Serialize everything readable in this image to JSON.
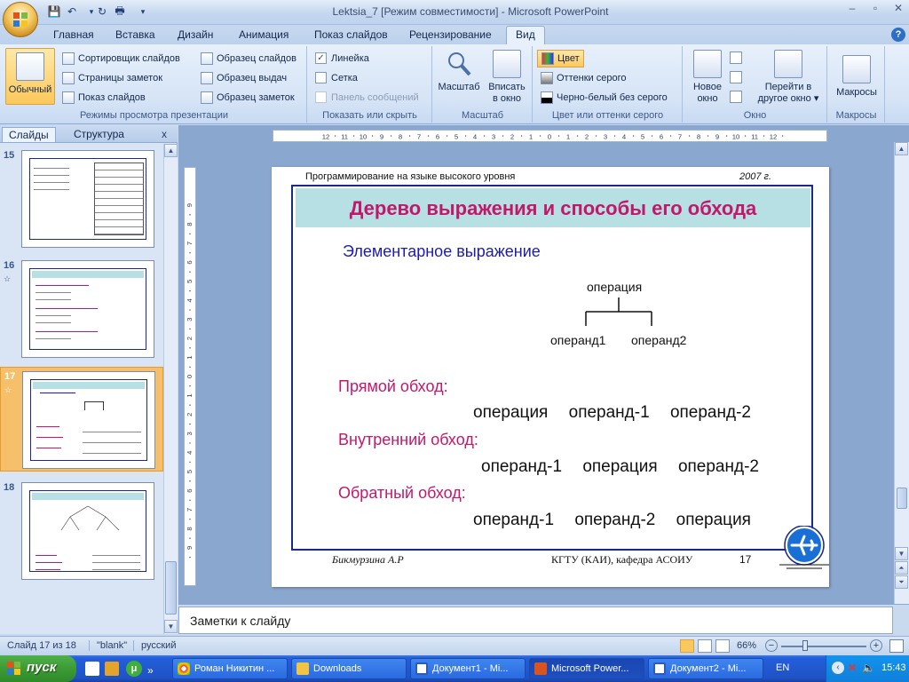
{
  "window": {
    "title": "Lektsia_7 [Режим совместимости] - Microsoft PowerPoint",
    "controls": [
      "–",
      "▫",
      "✕"
    ]
  },
  "qat": [
    "save",
    "undo",
    "redo",
    "print"
  ],
  "tabs": [
    "Главная",
    "Вставка",
    "Дизайн",
    "Анимация",
    "Показ слайдов",
    "Рецензирование",
    "Вид"
  ],
  "ribbon": {
    "views": {
      "normal": "Обычный",
      "sorter": "Сортировщик слайдов",
      "notes_pages": "Страницы заметок",
      "slideshow": "Показ слайдов",
      "label": "Режимы просмотра презентации"
    },
    "masters": {
      "slide_master": "Образец слайдов",
      "handout_master": "Образец выдач",
      "notes_master": "Образец заметок"
    },
    "showhide": {
      "ruler": "Линейка",
      "grid": "Сетка",
      "message_bar": "Панель сообщений",
      "label": "Показать или скрыть"
    },
    "zoom": {
      "zoom": "Масштаб",
      "fit_line1": "Вписать",
      "fit_line2": "в окно",
      "label": "Масштаб"
    },
    "color": {
      "color": "Цвет",
      "grayscale": "Оттенки серого",
      "bw": "Черно-белый без серого",
      "label": "Цвет или оттенки серого"
    },
    "window": {
      "new_line1": "Новое",
      "new_line2": "окно",
      "switch_line1": "Перейти в",
      "switch_line2": "другое окно",
      "label": "Окно"
    },
    "macros": {
      "macros": "Макросы",
      "label": "Макросы"
    }
  },
  "pane": {
    "tab_slides": "Слайды",
    "tab_outline": "Структура",
    "close": "x",
    "slides": [
      {
        "num": "15",
        "anim": ""
      },
      {
        "num": "16",
        "anim": "☆"
      },
      {
        "num": "17",
        "anim": "☆"
      },
      {
        "num": "18",
        "anim": ""
      }
    ]
  },
  "slide": {
    "header_left": "Программирование на языке высокого уровня",
    "header_right": "2007 г.",
    "title": "Дерево выражения и способы его обхода",
    "subtitle": "Элементарное выражение",
    "tree_root": "операция",
    "tree_left": "операнд1",
    "tree_right": "операнд2",
    "pre_label": "Прямой обход:",
    "pre_seq": [
      "операция",
      "операнд-1",
      "операнд-2"
    ],
    "in_label": "Внутренний обход:",
    "in_seq": [
      "операнд-1",
      "операция",
      "операнд-2"
    ],
    "post_label": "Обратный обход:",
    "post_seq": [
      "операнд-1",
      "операнд-2",
      "операция"
    ],
    "footer_author": "Бикмурзина А.Р",
    "footer_org": "КГТУ (КАИ), кафедра АСОИУ",
    "footer_page": "17",
    "colors": {
      "title_bg": "#b6e0e3",
      "title": "#c2186b",
      "subtitle": "#1c1cb0",
      "frame": "#1b2a8a"
    }
  },
  "notes": {
    "placeholder": "Заметки к слайду"
  },
  "status": {
    "slide_of": "Слайд 17 из 18",
    "theme": "\"blank\"",
    "language": "русский",
    "zoom": "66%"
  },
  "taskbar": {
    "start": "пуск",
    "tasks": [
      {
        "label": "Роман Никитин ...",
        "active": false
      },
      {
        "label": "Downloads",
        "active": false
      },
      {
        "label": "Документ1 - Mi...",
        "active": false
      },
      {
        "label": "Microsoft Power...",
        "active": true
      },
      {
        "label": "Документ2 - Mi...",
        "active": false
      }
    ],
    "lang": "EN",
    "time": "15:43"
  }
}
